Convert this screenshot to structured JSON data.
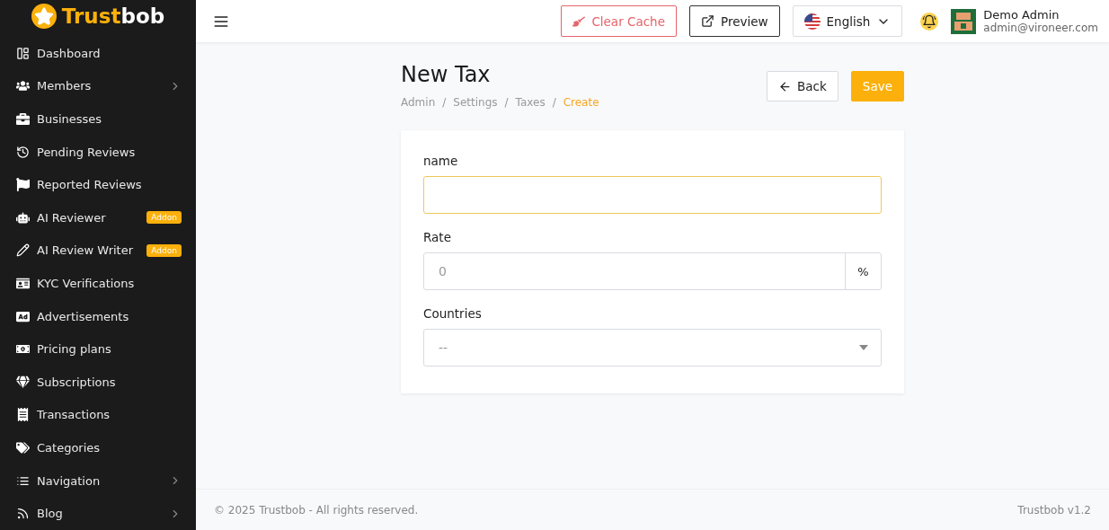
{
  "brand": {
    "first": "Trust",
    "second": "bob"
  },
  "sidebar": {
    "items": [
      {
        "label": "Dashboard",
        "has_children": false
      },
      {
        "label": "Members",
        "has_children": true
      },
      {
        "label": "Businesses",
        "has_children": false
      },
      {
        "label": "Pending Reviews",
        "has_children": false
      },
      {
        "label": "Reported Reviews",
        "has_children": false
      },
      {
        "label": "AI Reviewer",
        "has_children": false,
        "badge": "Addon"
      },
      {
        "label": "AI Review Writer",
        "has_children": false,
        "badge": "Addon"
      },
      {
        "label": "KYC Verifications",
        "has_children": false
      },
      {
        "label": "Advertisements",
        "has_children": false
      },
      {
        "label": "Pricing plans",
        "has_children": false
      },
      {
        "label": "Subscriptions",
        "has_children": false
      },
      {
        "label": "Transactions",
        "has_children": false
      },
      {
        "label": "Categories",
        "has_children": false
      },
      {
        "label": "Navigation",
        "has_children": true
      },
      {
        "label": "Blog",
        "has_children": true
      }
    ]
  },
  "topbar": {
    "clear_cache": "Clear Cache",
    "preview": "Preview",
    "language": "English",
    "user_name": "Demo Admin",
    "user_email": "admin@vironeer.com"
  },
  "page": {
    "title": "New Tax",
    "separator": "/",
    "breadcrumbs": [
      {
        "label": "Admin",
        "current": false
      },
      {
        "label": "Settings",
        "current": false
      },
      {
        "label": "Taxes",
        "current": false
      },
      {
        "label": "Create",
        "current": true
      }
    ],
    "back": "Back",
    "save": "Save"
  },
  "form": {
    "fields": [
      {
        "kind": "text",
        "label": "name",
        "focused": true
      },
      {
        "kind": "addon",
        "label": "Rate",
        "placeholder": "0",
        "addon": "%",
        "focused": false
      },
      {
        "kind": "select",
        "label": "Countries",
        "value": "--",
        "focused": false
      }
    ]
  },
  "footer": {
    "copyright": "© 2025 Trustbob - All rights reserved.",
    "version": "Trustbob v1.2"
  }
}
